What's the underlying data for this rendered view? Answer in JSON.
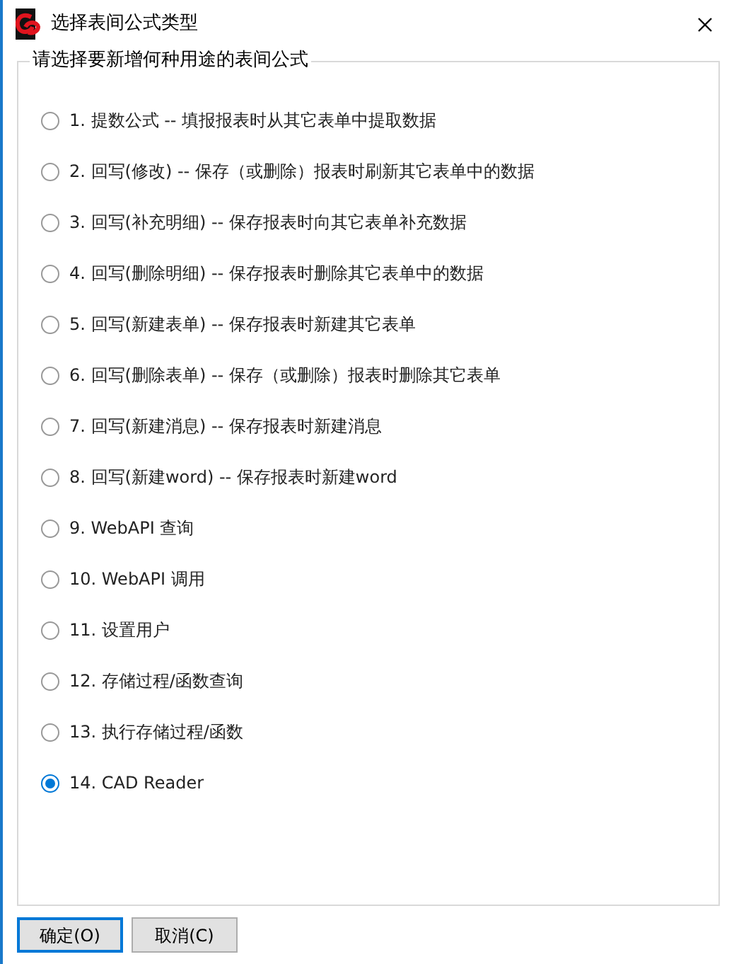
{
  "window": {
    "title": "选择表间公式类型"
  },
  "group": {
    "legend": "请选择要新增何种用途的表间公式"
  },
  "options": [
    {
      "label": "1. 提数公式 -- 填报报表时从其它表单中提取数据",
      "selected": false
    },
    {
      "label": "2. 回写(修改) -- 保存（或删除）报表时刷新其它表单中的数据",
      "selected": false
    },
    {
      "label": "3. 回写(补充明细) -- 保存报表时向其它表单补充数据",
      "selected": false
    },
    {
      "label": "4. 回写(删除明细) -- 保存报表时删除其它表单中的数据",
      "selected": false
    },
    {
      "label": "5. 回写(新建表单) -- 保存报表时新建其它表单",
      "selected": false
    },
    {
      "label": "6. 回写(删除表单) -- 保存（或删除）报表时删除其它表单",
      "selected": false
    },
    {
      "label": "7. 回写(新建消息) -- 保存报表时新建消息",
      "selected": false
    },
    {
      "label": "8. 回写(新建word) -- 保存报表时新建word",
      "selected": false
    },
    {
      "label": "9. WebAPI 查询",
      "selected": false
    },
    {
      "label": "10. WebAPI 调用",
      "selected": false
    },
    {
      "label": "11. 设置用户",
      "selected": false
    },
    {
      "label": "12. 存储过程/函数查询",
      "selected": false
    },
    {
      "label": "13. 执行存储过程/函数",
      "selected": false
    },
    {
      "label": "14. CAD Reader",
      "selected": true
    }
  ],
  "buttons": [
    {
      "label": "确定(O)",
      "default": true
    },
    {
      "label": "取消(C)",
      "default": false
    }
  ]
}
